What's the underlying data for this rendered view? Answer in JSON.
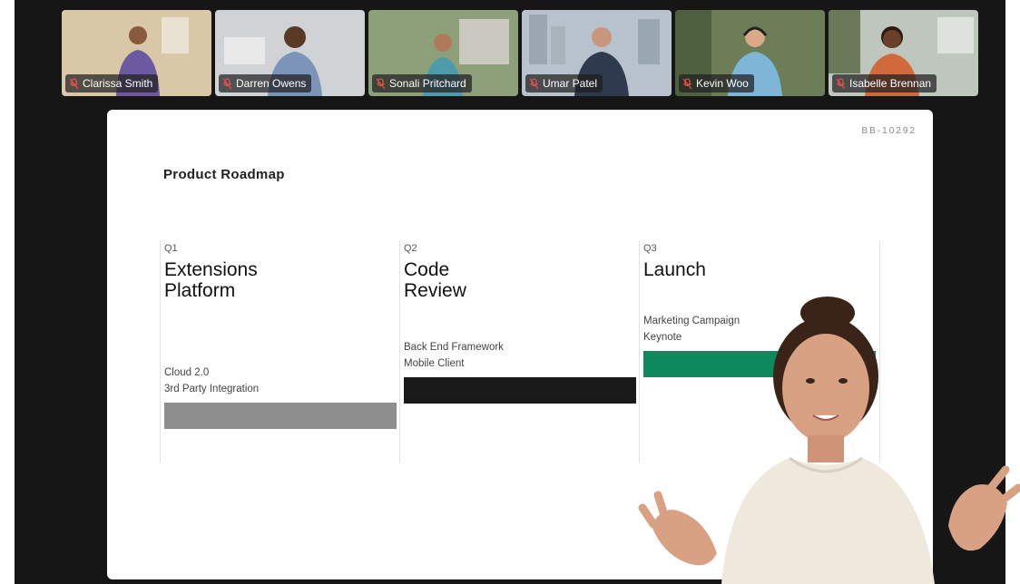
{
  "participants": [
    {
      "name": "Clarissa Smith",
      "bg": "#d9c8a8",
      "shirt": "#6b5aa0",
      "skin": "#8a5a3c"
    },
    {
      "name": "Darren Owens",
      "bg": "#cfd3d6",
      "shirt": "#7c94b8",
      "skin": "#5a3a26"
    },
    {
      "name": "Sonali Pritchard",
      "bg": "#8ea07a",
      "shirt": "#4f9aa8",
      "skin": "#b07a58"
    },
    {
      "name": "Umar Patel",
      "bg": "#b7c2cc",
      "shirt": "#2e3a4e",
      "skin": "#c8967a"
    },
    {
      "name": "Kevin Woo",
      "bg": "#6d7d58",
      "shirt": "#7fb6d8",
      "skin": "#d8aa88"
    },
    {
      "name": "Isabelle Brennan",
      "bg": "#bfc6be",
      "shirt": "#d06a3c",
      "skin": "#6a4028"
    }
  ],
  "slide": {
    "id": "BB-10292",
    "title": "Product Roadmap",
    "columns": [
      {
        "quarter": "Q1",
        "heading_line1": "Extensions",
        "heading_line2": "Platform",
        "items": [
          "Cloud 2.0",
          "3rd Party Integration"
        ],
        "bar_color": "#8e8e8e"
      },
      {
        "quarter": "Q2",
        "heading_line1": "Code",
        "heading_line2": "Review",
        "items": [
          "Back End Framework",
          "Mobile Client"
        ],
        "bar_color": "#1a1a1a"
      },
      {
        "quarter": "Q3",
        "heading_line1": "Launch",
        "heading_line2": "",
        "items": [
          "Marketing Campaign",
          "Keynote"
        ],
        "bar_color": "#0d8a5c"
      }
    ]
  },
  "colors": {
    "stage": "#161616",
    "muted_mic": "#e0504a"
  }
}
